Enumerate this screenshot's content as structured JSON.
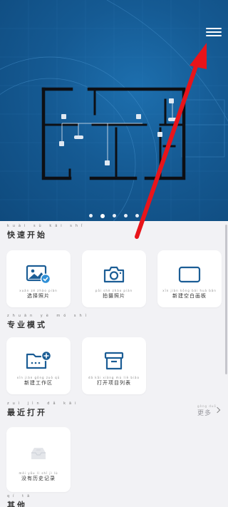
{
  "hero": {
    "banner_indicator": {
      "count": 5,
      "active_index": 1
    },
    "menu_icon": "hamburger-menu-icon"
  },
  "quick_start": {
    "title": "快速开始",
    "title_pinyin": "kuài sù kāi shǐ",
    "items": [
      {
        "label": "选择照片",
        "pinyin": "xuǎn zé zhào piàn",
        "icon": "photo-check-icon"
      },
      {
        "label": "拍摄照片",
        "pinyin": "pāi shè zhào piàn",
        "icon": "camera-icon"
      },
      {
        "label": "新建空白画板",
        "pinyin": "xīn jiàn kōng bái huà bǎn",
        "icon": "blank-canvas-icon"
      }
    ]
  },
  "pro_mode": {
    "title": "专业模式",
    "title_pinyin": "zhuān yè mó shì",
    "items": [
      {
        "label": "新建工作区",
        "pinyin": "xīn jiàn gōng zuò qū",
        "icon": "folder-add-icon"
      },
      {
        "label": "打开项目列表",
        "pinyin": "dǎ kāi xiàng mù liè biǎo",
        "icon": "archive-box-icon"
      }
    ]
  },
  "recent": {
    "title": "最近打开",
    "title_pinyin": "zuì jìn dǎ kāi",
    "more_label": "更多",
    "more_pinyin": "gèng duō",
    "empty_label": "没有历史记录",
    "empty_pinyin": "méi yǒu lì shǐ jì lù"
  },
  "other": {
    "title": "其他",
    "title_pinyin": "qí tā"
  },
  "colors": {
    "hero_blue": "#155a93",
    "accent": "#1b5d95",
    "annotation_red": "#e8141a",
    "background": "#f2f2f5"
  }
}
